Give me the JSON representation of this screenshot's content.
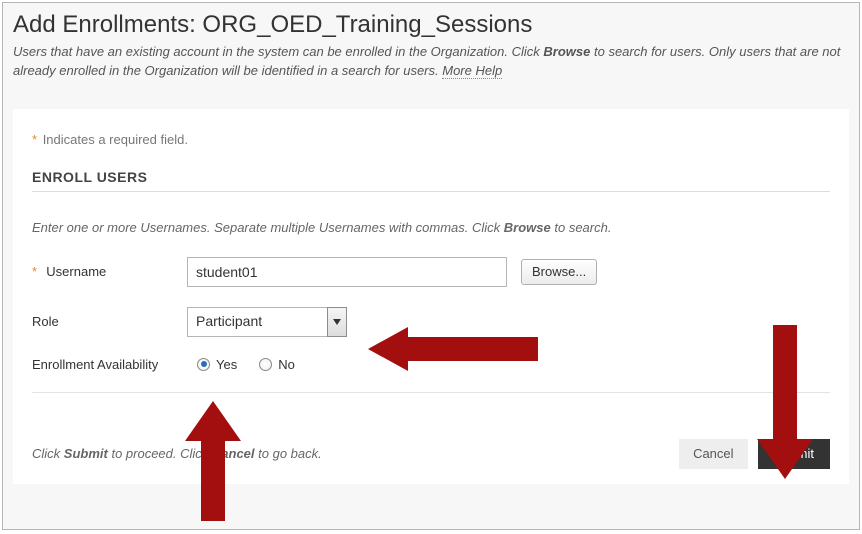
{
  "header": {
    "title": "Add Enrollments: ORG_OED_Training_Sessions",
    "desc_1": "Users that have an existing account in the system can be enrolled in the Organization. Click ",
    "desc_browse": "Browse",
    "desc_2": " to search for users. Only users that are not already enrolled in the Organization will be identified in a search for users. ",
    "more_help": "More Help"
  },
  "panel": {
    "required_note": "Indicates a required field.",
    "section_title": "ENROLL USERS",
    "sub_instr_1": "Enter one or more Usernames. Separate multiple Usernames with commas. Click ",
    "sub_instr_browse": "Browse",
    "sub_instr_2": " to search."
  },
  "form": {
    "username_label": "Username",
    "username_value": "student01",
    "browse_label": "Browse...",
    "role_label": "Role",
    "role_value": "Participant",
    "avail_label": "Enrollment Availability",
    "avail_yes": "Yes",
    "avail_no": "No"
  },
  "footer": {
    "instr_1": "Click ",
    "instr_submit": "Submit",
    "instr_2": " to proceed. Click ",
    "instr_cancel": "Cancel",
    "instr_3": " to go back.",
    "cancel_label": "Cancel",
    "submit_label": "Submit"
  },
  "colors": {
    "arrow": "#A30E0E"
  }
}
